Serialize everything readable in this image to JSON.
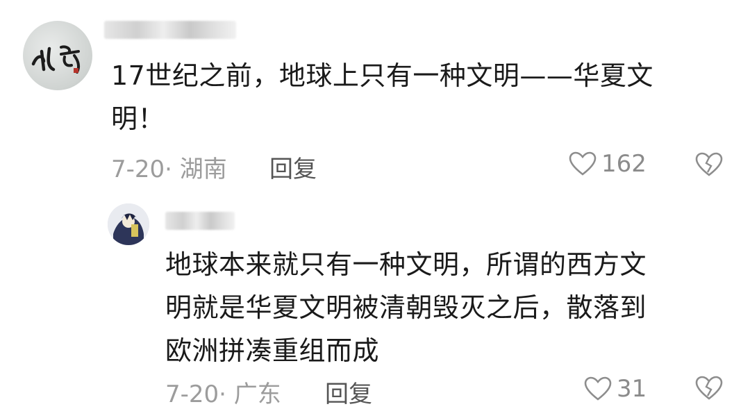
{
  "main_comment": {
    "text_line1": "17世纪之前，地球上只有一种文明——华夏文",
    "text_line2": "明！",
    "meta": "7-20· 湖南",
    "reply_label": "回复",
    "like_count": "162"
  },
  "reply_comment": {
    "text_line1": "地球本来就只有一种文明，所谓的西方文",
    "text_line2": "明就是华夏文明被清朝毁灭之后，散落到",
    "text_line3": "欧洲拼凑重组而成",
    "meta": "7-20· 广东",
    "reply_label": "回复",
    "like_count": "31"
  },
  "icons": {
    "like": "heart-outline-icon",
    "dislike": "broken-heart-icon"
  },
  "colors": {
    "text": "#1a1a1a",
    "meta": "#9c9c9c",
    "reply": "#555555",
    "background": "#ffffff"
  }
}
